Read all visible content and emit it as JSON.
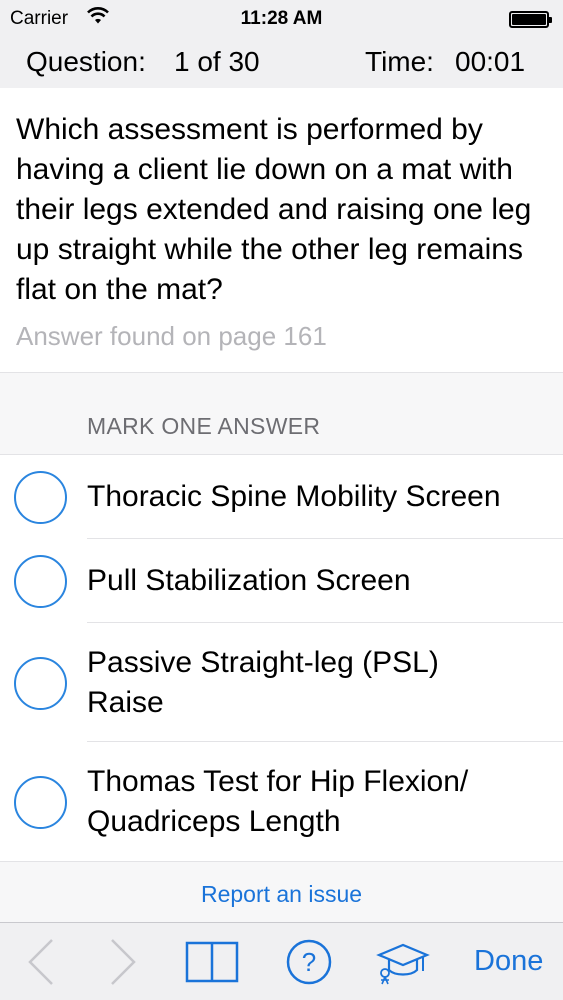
{
  "status_bar": {
    "carrier": "Carrier",
    "time": "11:28 AM",
    "wifi_icon": "wifi-icon",
    "battery_icon": "battery-icon"
  },
  "quiz_header": {
    "question_label": "Question:",
    "question_value": "1 of 30",
    "time_label": "Time:",
    "time_value": "00:01"
  },
  "question": {
    "text": "Which assessment is performed by having a client lie down on a mat with their legs extended and raising one leg up straight while the other leg remains flat on the mat?",
    "answer_reference": "Answer found on page 161"
  },
  "answers": {
    "section_label": "MARK ONE ANSWER",
    "options": [
      {
        "label": "Thoracic Spine Mobility Screen",
        "selected": false
      },
      {
        "label": "Pull Stabilization Screen",
        "selected": false
      },
      {
        "label": "Passive Straight-leg (PSL) Raise",
        "selected": false
      },
      {
        "label": "Thomas Test for Hip Flexion/ Quadriceps Length",
        "selected": false
      }
    ]
  },
  "report_link": "Report an issue",
  "toolbar": {
    "back_icon": "chevron-left-icon",
    "forward_icon": "chevron-right-icon",
    "book_icon": "book-icon",
    "help_icon": "question-circle-icon",
    "help_glyph": "?",
    "grad_icon": "graduation-cap-icon",
    "done_label": "Done"
  },
  "colors": {
    "accent": "#1a73d9",
    "radio": "#2a85df",
    "disabled": "#c7c7cc",
    "secondary_text": "#b4b4b8"
  }
}
